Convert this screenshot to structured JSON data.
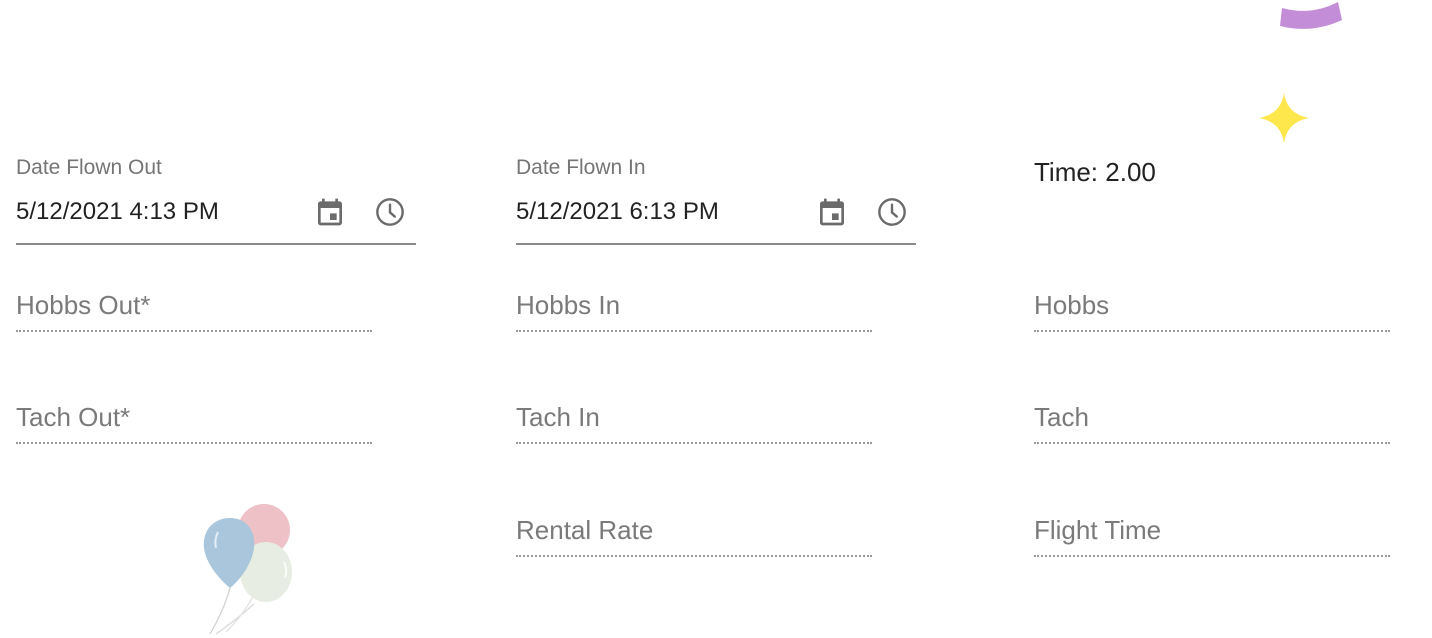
{
  "date_out": {
    "label": "Date Flown Out",
    "value": "5/12/2021 4:13 PM"
  },
  "date_in": {
    "label": "Date Flown In",
    "value": "5/12/2021 6:13 PM"
  },
  "time_readout": "Time: 2.00",
  "fields": {
    "hobbs_out": "Hobbs Out*",
    "hobbs_in": "Hobbs In",
    "hobbs": "Hobbs",
    "tach_out": "Tach Out*",
    "tach_in": "Tach In",
    "tach": "Tach",
    "rental_rate": "Rental Rate",
    "flight_time": "Flight Time"
  },
  "icons": {
    "calendar": "calendar-icon",
    "clock": "clock-icon",
    "star": "sparkle-star-icon",
    "balloons": "balloons-icon",
    "confetti": "confetti-arc-icon"
  },
  "colors": {
    "star": "#FDE74C",
    "confetti": "#C48DD8",
    "balloon_blue": "#A9C6DC",
    "balloon_pink": "#EDC1C5",
    "balloon_green": "#E7EDE2",
    "underline": "#8A8A8A",
    "label": "#757575"
  }
}
